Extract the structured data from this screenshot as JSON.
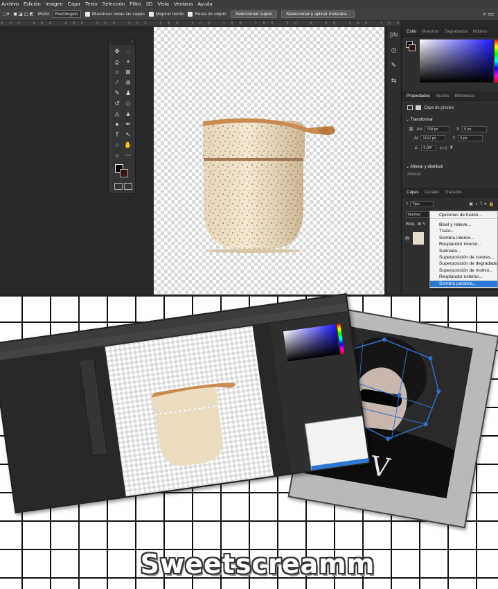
{
  "menu": [
    "Archivo",
    "Edición",
    "Imagen",
    "Capa",
    "Texto",
    "Selección",
    "Filtro",
    "3D",
    "Vista",
    "Ventana",
    "Ayuda"
  ],
  "options": {
    "mode_label": "Modo:",
    "mode_value": "Rectángulo",
    "sample_all": "Muestrear todas las capas",
    "enhance_edge": "Mejorar borde",
    "object_subtract": "Resta de objeto",
    "select_subject": "Seleccionar sujeto",
    "select_mask": "Seleccionar y aplicar máscara..."
  },
  "ruler_ticks": "500 450 400 350 300 250 200 150 100 50 0 50 100 150 200 250 300 350 400 450 500 550 600 650 700 750 800 850 900 950",
  "color_panel": {
    "tabs": [
      "Color",
      "Muestras",
      "Degradados",
      "Motivos"
    ]
  },
  "properties": {
    "tabs": [
      "Propiedades",
      "Ajustes",
      "Bibliotecas"
    ],
    "layer_type": "Capa de píxeles",
    "transform_title": "Transformar",
    "w_label": "An",
    "w_value": "768 px",
    "h_label": "Al",
    "h_value": "1152 px",
    "x_label": "X",
    "x_value": "0 px",
    "y_label": "Y",
    "y_value": "0 px",
    "angle_value": "0,00°",
    "align_title": "Alinear y distribuir",
    "align_sub": "Alinear:"
  },
  "layers": {
    "tabs": [
      "Capas",
      "Canales",
      "Trazados"
    ],
    "search": "Tipo",
    "blend": "Normal",
    "lock": "Bloq.:"
  },
  "fx_menu": {
    "header": "Opciones de fusión...",
    "items": [
      "Bisel y relieve...",
      "Trazo...",
      "Sombra interior...",
      "Resplandor interior...",
      "Satinado...",
      "Superposición de colores...",
      "Superposición de degradado...",
      "Superposición de motivo...",
      "Resplandor exterior...",
      "Sombra paralela..."
    ],
    "selected_index": 9
  },
  "watermark": "Sweetscreamm",
  "colors": {
    "app_bg": "#282828",
    "panel_bg": "#2f2f2f",
    "highlight": "#2b78d4",
    "handle_blue": "#2f6fd1"
  }
}
